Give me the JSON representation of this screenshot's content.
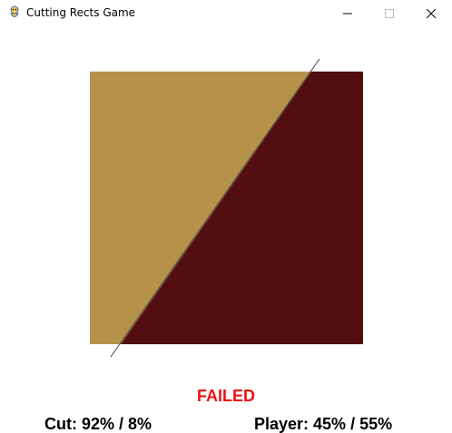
{
  "window": {
    "title": "Cutting Rects Game",
    "icon": "pygame-snake-icon",
    "controls": [
      "minimize-icon",
      "maximize-icon",
      "close-icon"
    ]
  },
  "game": {
    "status": "FAILED",
    "cut_label": "Cut: 92% / 8%",
    "player_label": "Player: 45% / 55%"
  },
  "colors": {
    "left_piece": "#b5924a",
    "right_piece": "#520e10",
    "cut_line": "#444444",
    "status_text": "#ee1111",
    "score_text": "#000000"
  }
}
